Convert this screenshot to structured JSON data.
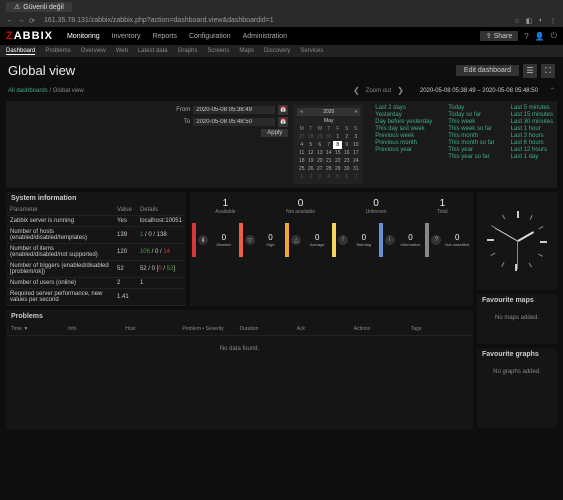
{
  "browser": {
    "tab_title": "Güvenli değil",
    "url": "161.35.78.131/zabbix/zabbix.php?action=dashboard.view&dashboardid=1"
  },
  "logo": {
    "z": "Z",
    "rest": "ABBIX"
  },
  "main_nav": [
    "Monitoring",
    "Inventory",
    "Reports",
    "Configuration",
    "Administration"
  ],
  "share_label": "Share",
  "sub_nav": [
    "Dashboard",
    "Problems",
    "Overview",
    "Web",
    "Latest data",
    "Graphs",
    "Screens",
    "Maps",
    "Discovery",
    "Services"
  ],
  "page_title": "Global view",
  "edit_label": "Edit dashboard",
  "breadcrumb": {
    "all": "All dashboards",
    "current": "Global view"
  },
  "zoom_out": "Zoom out",
  "time_range": "2020-05-08 05:38:49 – 2020-05-08 05:48:50",
  "time_form": {
    "from_label": "From",
    "from_value": "2020-05-08 05:38:49",
    "to_label": "To",
    "to_value": "2020-05-08 05:48:50",
    "apply": "Apply"
  },
  "calendar": {
    "year": "2020",
    "month": "May",
    "dow": [
      "M",
      "T",
      "W",
      "T",
      "F",
      "S",
      "S"
    ],
    "rows": [
      [
        "27",
        "28",
        "29",
        "30",
        "1",
        "2",
        "3"
      ],
      [
        "4",
        "5",
        "6",
        "7",
        "8",
        "9",
        "10"
      ],
      [
        "11",
        "12",
        "13",
        "14",
        "15",
        "16",
        "17"
      ],
      [
        "18",
        "19",
        "20",
        "21",
        "22",
        "23",
        "24"
      ],
      [
        "25",
        "26",
        "27",
        "28",
        "29",
        "30",
        "31"
      ],
      [
        "1",
        "2",
        "3",
        "4",
        "5",
        "6",
        "7"
      ]
    ],
    "selected": "8"
  },
  "quick_links": {
    "col1": [
      "Last 2 days",
      "Yesterday",
      "Day before yesterday",
      "This day last week",
      "Previous week",
      "Previous month",
      "Previous year"
    ],
    "col2": [
      "Today",
      "Today so far",
      "This week",
      "This week so far",
      "This month",
      "This month so far",
      "This year",
      "This year so far"
    ],
    "col3": [
      "Last 5 minutes",
      "Last 15 minutes",
      "Last 30 minutes",
      "Last 1 hour",
      "Last 3 hours",
      "Last 6 hours",
      "Last 12 hours",
      "Last 1 day"
    ]
  },
  "sysinfo": {
    "title": "System information",
    "headers": [
      "Parameter",
      "Value",
      "Details"
    ],
    "rows": [
      {
        "param": "Zabbix server is running",
        "value": "Yes",
        "value_class": "green",
        "details": "localhost:10051"
      },
      {
        "param": "Number of hosts (enabled/disabled/templates)",
        "value": "139",
        "details_html": "1 / 0 / 138"
      },
      {
        "param": "Number of items (enabled/disabled/not supported)",
        "value": "120",
        "details_html": "106 / 0 / 14"
      },
      {
        "param": "Number of triggers (enabled/disabled [problem/ok])",
        "value": "52",
        "details_html": "52 / 0 [0 / 52]"
      },
      {
        "param": "Number of users (online)",
        "value": "2",
        "details": "1"
      },
      {
        "param": "Required server performance, new values per second",
        "value": "1.41",
        "details": ""
      }
    ]
  },
  "status": {
    "counts": [
      {
        "num": "1",
        "lbl": "Available"
      },
      {
        "num": "0",
        "lbl": "Not available"
      },
      {
        "num": "0",
        "lbl": "Unknown"
      },
      {
        "num": "1",
        "lbl": "Total"
      }
    ],
    "severities": [
      {
        "color": "#d63939",
        "num": "0",
        "lbl": "Disaster",
        "badge": "⬇"
      },
      {
        "color": "#e9614b",
        "num": "0",
        "lbl": "High",
        "badge": "▽"
      },
      {
        "color": "#f0a742",
        "num": "0",
        "lbl": "Average",
        "badge": "△"
      },
      {
        "color": "#f4d35e",
        "num": "0",
        "lbl": "Warning",
        "badge": "!"
      },
      {
        "color": "#6b8fd8",
        "num": "0",
        "lbl": "Information",
        "badge": "i"
      },
      {
        "color": "#888",
        "num": "0",
        "lbl": "Not classified",
        "badge": "?"
      }
    ]
  },
  "problems": {
    "title": "Problems",
    "headers": [
      "Time ▼",
      "Info",
      "Host",
      "Problem • Severity",
      "Duration",
      "Ack",
      "Actions",
      "Tags"
    ],
    "no_data": "No data found."
  },
  "fav_maps": {
    "title": "Favourite maps",
    "empty": "No maps added."
  },
  "fav_graphs": {
    "title": "Favourite graphs",
    "empty": "No graphs added."
  }
}
